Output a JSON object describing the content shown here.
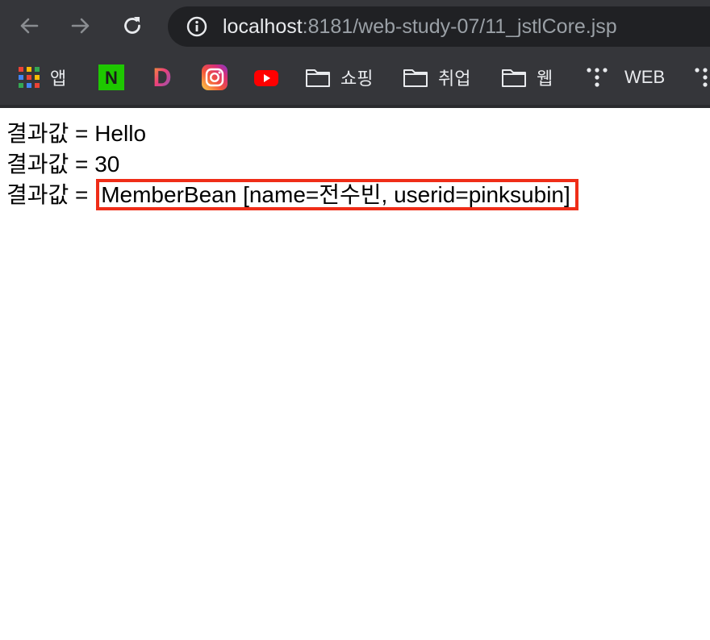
{
  "browser": {
    "url_host": "localhost",
    "url_rest": ":8181/web-study-07/11_jstlCore.jsp"
  },
  "bookmarks": [
    {
      "label": "앱",
      "icon": "apps-grid-icon"
    },
    {
      "label": "",
      "icon": "naver-icon"
    },
    {
      "label": "",
      "icon": "daum-icon"
    },
    {
      "label": "",
      "icon": "instagram-icon"
    },
    {
      "label": "",
      "icon": "youtube-icon"
    },
    {
      "label": "쇼핑",
      "icon": "folder-icon"
    },
    {
      "label": "취업",
      "icon": "folder-icon"
    },
    {
      "label": "웹",
      "icon": "folder-icon"
    },
    {
      "label": "WEB",
      "icon": "dots-icon"
    }
  ],
  "icons": {
    "naver_letter": "N",
    "daum_letter": "D"
  },
  "content": {
    "lines": [
      {
        "prefix": "결과값 = ",
        "value": "Hello"
      },
      {
        "prefix": "결과값 = ",
        "value": "30"
      },
      {
        "prefix": "결과값 = ",
        "value": "MemberBean [name=전수빈, userid=pinksubin]"
      }
    ]
  },
  "colors": {
    "highlight_border": "#ef2d18",
    "toolbar_bg": "#35363a",
    "omnibox_bg": "#202124"
  }
}
